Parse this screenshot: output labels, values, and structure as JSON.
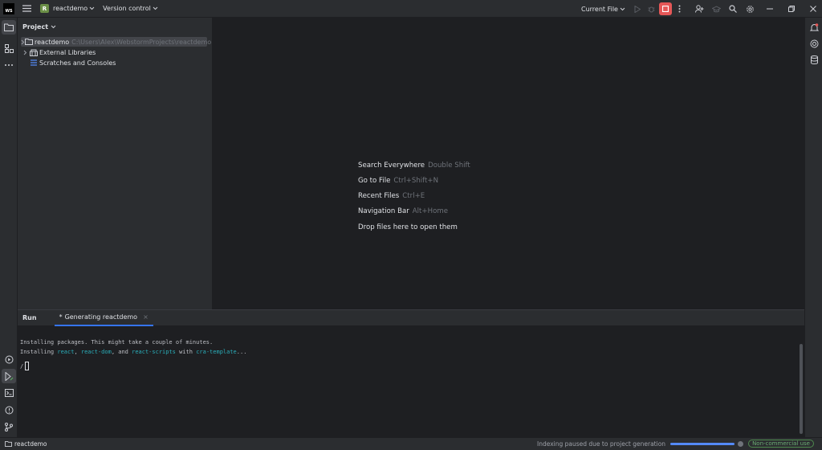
{
  "titlebar": {
    "app_logo": "WS",
    "project_badge": "R",
    "project_name": "reactdemo",
    "vcs_label": "Version control",
    "run_config": "Current File"
  },
  "project_panel": {
    "title": "Project",
    "tree": [
      {
        "label": "reactdemo",
        "path": "C:\\Users\\Alex\\WebstormProjects\\reactdemo",
        "icon": "folder-icon",
        "expandable": true,
        "selected": true
      },
      {
        "label": "External Libraries",
        "path": "",
        "icon": "library-icon",
        "expandable": true,
        "selected": false
      },
      {
        "label": "Scratches and Consoles",
        "path": "",
        "icon": "scratches-icon",
        "expandable": false,
        "selected": false
      }
    ]
  },
  "editor": {
    "hints": [
      {
        "label": "Search Everywhere",
        "shortcut": "Double Shift"
      },
      {
        "label": "Go to File",
        "shortcut": "Ctrl+Shift+N"
      },
      {
        "label": "Recent Files",
        "shortcut": "Ctrl+E"
      },
      {
        "label": "Navigation Bar",
        "shortcut": "Alt+Home"
      },
      {
        "label": "Drop files here to open them",
        "shortcut": ""
      }
    ]
  },
  "run_window": {
    "title": "Run",
    "tab_label": "Generating reactdemo",
    "console": {
      "line1": "Installing packages. This might take a couple of minutes.",
      "line2_prefix": "Installing ",
      "pkg1": "react",
      "sep1": ", ",
      "pkg2": "react-dom",
      "sep2": ", and ",
      "pkg3": "react-scripts",
      "sep3": " with ",
      "pkg4": "cra-template",
      "line2_suffix": "...",
      "spinner": "/"
    }
  },
  "statusbar": {
    "project": "reactdemo",
    "message": "Indexing paused due to project generation",
    "progress": 1.0,
    "license": "Non-commercial use"
  },
  "colors": {
    "accent": "#3574f0",
    "stop_button": "#e55757",
    "project_badge": "#6b8f47",
    "console_package": "#2aacb8",
    "license_green": "#6aab73"
  }
}
